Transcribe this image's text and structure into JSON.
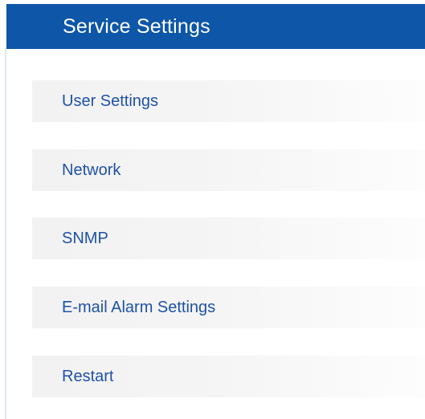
{
  "header": {
    "title": "Service Settings"
  },
  "menu": {
    "items": [
      {
        "label": "User Settings"
      },
      {
        "label": "Network"
      },
      {
        "label": "SNMP"
      },
      {
        "label": "E-mail Alarm Settings"
      },
      {
        "label": "Restart"
      }
    ]
  },
  "colors": {
    "header_background": "#0d56a8",
    "header_text": "#ffffff",
    "menu_text": "#1e52a4"
  }
}
